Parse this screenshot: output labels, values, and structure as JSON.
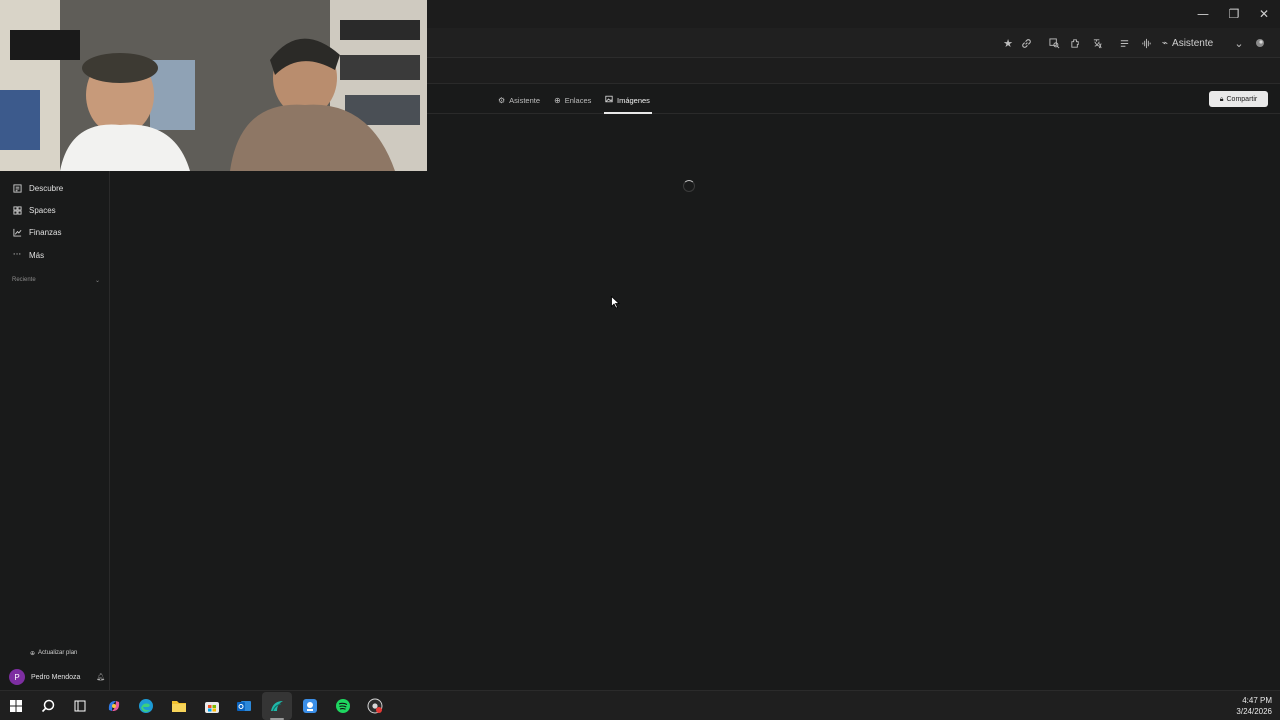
{
  "window": {
    "minimize_glyph": "—",
    "restore_glyph": "❐",
    "close_glyph": "✕"
  },
  "toolbar": {
    "assistant_label": "Asistente",
    "icons": [
      "star-icon",
      "link-icon",
      "zoom-page-icon",
      "extension-icon",
      "translate-icon",
      "reader-icon",
      "audio-icon"
    ]
  },
  "sidebar": {
    "items": [
      {
        "label": "Descubre",
        "icon": "discover-icon"
      },
      {
        "label": "Spaces",
        "icon": "spaces-icon"
      },
      {
        "label": "Finanzas",
        "icon": "finance-icon"
      },
      {
        "label": "Más",
        "icon": "more-icon"
      }
    ],
    "recent_label": "Reciente",
    "upgrade_label": "Actualizar plan",
    "user": {
      "initial": "P",
      "name": "Pedro Mendoza"
    }
  },
  "tabs": [
    {
      "label": "Asistente",
      "icon": "assistant-icon",
      "active": false
    },
    {
      "label": "Enlaces",
      "icon": "globe-icon",
      "active": false
    },
    {
      "label": "Imágenes",
      "icon": "image-icon",
      "active": true
    }
  ],
  "share_label": "Compartir",
  "taskbar": {
    "time": "4:47 PM",
    "date": "3/24/2026",
    "apps": [
      "windows-start-icon",
      "search-icon",
      "task-view-icon",
      "copilot-icon",
      "edge-icon",
      "file-explorer-icon",
      "store-icon",
      "outlook-icon",
      "perplexity-browser-icon",
      "app-icon",
      "spotify-icon",
      "chrome-canary-icon"
    ]
  },
  "colors": {
    "background": "#191a1a",
    "accent_avatar": "#7d2ea1",
    "share_bg": "#e9e9e9"
  }
}
